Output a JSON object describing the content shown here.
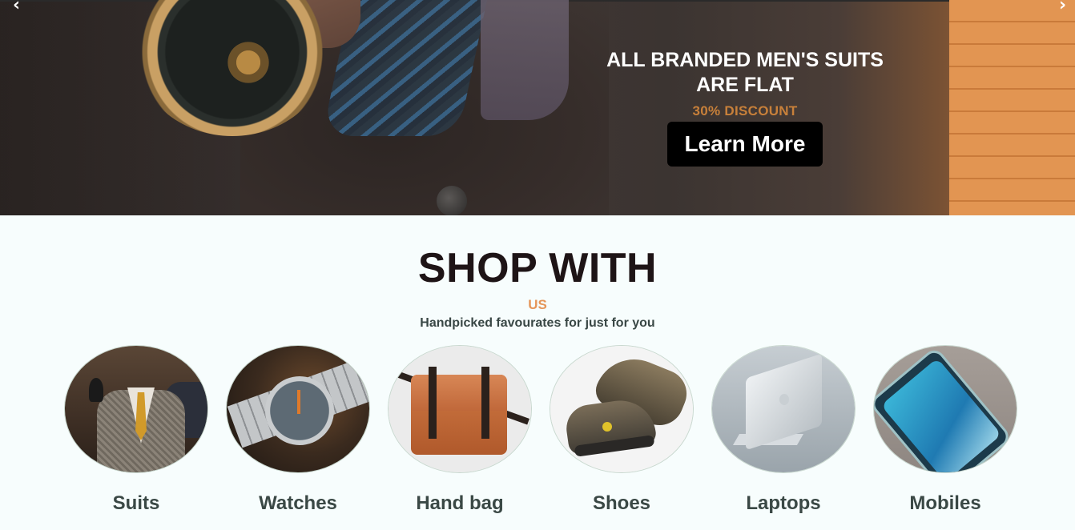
{
  "hero": {
    "prev_arrow": "‹",
    "next_arrow": "›",
    "title_line1": "ALL BRANDED MEN'S SUITS",
    "title_line2": "ARE FLAT",
    "discount": "30% DISCOUNT",
    "cta_label": "Learn More"
  },
  "shop": {
    "title": "SHOP WITH",
    "accent": "US",
    "subtitle": "Handpicked favourates for just for you",
    "categories": [
      {
        "label": "Suits"
      },
      {
        "label": "Watches"
      },
      {
        "label": "Hand bag"
      },
      {
        "label": "Shoes"
      },
      {
        "label": "Laptops"
      },
      {
        "label": "Mobiles"
      }
    ]
  },
  "colors": {
    "accent_orange": "#e5965a",
    "discount": "#c8803a",
    "cta_bg": "#000000",
    "title": "#1e1416",
    "label": "#3a4845"
  }
}
